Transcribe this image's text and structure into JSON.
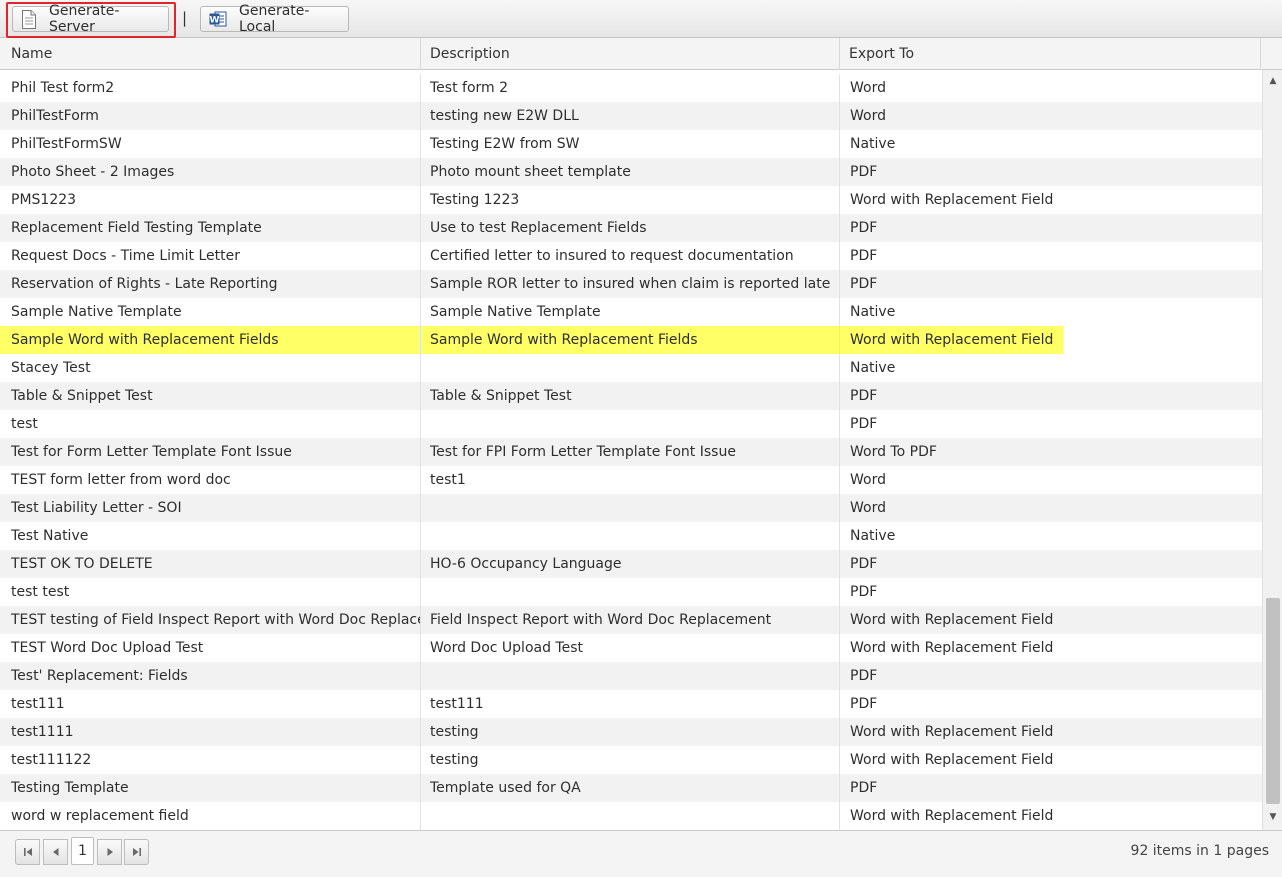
{
  "toolbar": {
    "generate_server_label": "Generate-Server",
    "separator": "|",
    "generate_local_label": "Generate-Local"
  },
  "columns": {
    "name": "Name",
    "description": "Description",
    "export_to": "Export To"
  },
  "rows": [
    {
      "name": "Phil Test form2",
      "description": "Test form 2",
      "export": "Word"
    },
    {
      "name": "PhilTestForm",
      "description": "testing new E2W DLL",
      "export": "Word"
    },
    {
      "name": "PhilTestFormSW",
      "description": "Testing E2W from SW",
      "export": "Native"
    },
    {
      "name": "Photo Sheet - 2 Images",
      "description": "Photo mount sheet template",
      "export": "PDF"
    },
    {
      "name": "PMS1223",
      "description": "Testing 1223",
      "export": "Word with Replacement Field"
    },
    {
      "name": "Replacement Field Testing Template",
      "description": "Use to test Replacement Fields",
      "export": "PDF"
    },
    {
      "name": "Request Docs - Time Limit Letter",
      "description": "Certified letter to insured to request documentation",
      "export": "PDF"
    },
    {
      "name": "Reservation of Rights - Late Reporting",
      "description": "Sample ROR letter to insured when claim is reported late",
      "export": "PDF"
    },
    {
      "name": "Sample Native Template",
      "description": "Sample Native Template",
      "export": "Native"
    },
    {
      "name": "Sample Word with Replacement Fields",
      "description": "Sample Word with Replacement Fields",
      "export": "Word with Replacement Field",
      "selected": true
    },
    {
      "name": "Stacey Test",
      "description": "",
      "export": "Native"
    },
    {
      "name": "Table & Snippet Test",
      "description": "Table & Snippet Test",
      "export": "PDF"
    },
    {
      "name": "test",
      "description": "",
      "export": "PDF"
    },
    {
      "name": "Test for Form Letter Template Font Issue",
      "description": "Test for FPI Form Letter Template Font Issue",
      "export": "Word To PDF"
    },
    {
      "name": "TEST form letter from word doc",
      "description": "test1",
      "export": "Word"
    },
    {
      "name": "Test Liability Letter - SOI",
      "description": "",
      "export": "Word"
    },
    {
      "name": "Test Native",
      "description": "",
      "export": "Native"
    },
    {
      "name": "TEST OK TO DELETE",
      "description": "HO-6 Occupancy Language",
      "export": "PDF"
    },
    {
      "name": "test test",
      "description": "",
      "export": "PDF"
    },
    {
      "name": "TEST testing of Field Inspect Report with Word Doc Replacement",
      "description": "Field Inspect Report with Word Doc Replacement",
      "export": "Word with Replacement Field"
    },
    {
      "name": "TEST Word Doc Upload Test",
      "description": "Word Doc Upload Test",
      "export": "Word with Replacement Field"
    },
    {
      "name": "Test' Replacement: Fields",
      "description": "",
      "export": "PDF"
    },
    {
      "name": "test111",
      "description": "test111",
      "export": "PDF"
    },
    {
      "name": "test1111",
      "description": "testing",
      "export": "Word with Replacement Field"
    },
    {
      "name": "test111122",
      "description": "testing",
      "export": "Word with Replacement Field"
    },
    {
      "name": "Testing Template",
      "description": "Template used for QA",
      "export": "PDF"
    },
    {
      "name": "word w replacement field",
      "description": "",
      "export": "Word with Replacement Field"
    }
  ],
  "pager": {
    "current_page": "1",
    "info": "92 items in 1 pages"
  },
  "icons": {
    "generate_server": "document-icon",
    "generate_local": "word-icon",
    "first": "first-page-icon",
    "prev": "prev-page-icon",
    "next": "next-page-icon",
    "last": "last-page-icon"
  },
  "colors": {
    "selection_highlight": "#ffff66",
    "emphasis_box": "#e0262a",
    "word_blue": "#2b5797"
  }
}
